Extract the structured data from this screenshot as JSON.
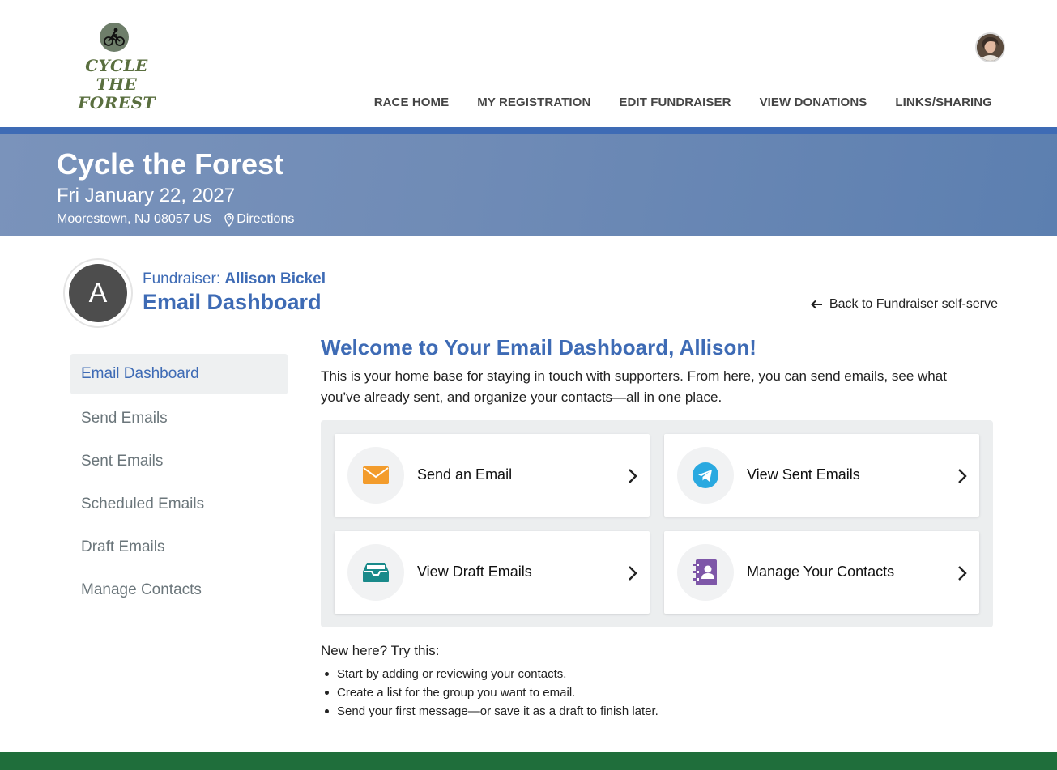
{
  "brand": {
    "logo_text": "CYCLE THE FOREST"
  },
  "nav": {
    "items": [
      {
        "label": "RACE HOME"
      },
      {
        "label": "MY REGISTRATION"
      },
      {
        "label": "EDIT FUNDRAISER"
      },
      {
        "label": "VIEW DONATIONS"
      },
      {
        "label": "LINKS/SHARING"
      }
    ]
  },
  "event": {
    "title": "Cycle the Forest",
    "date": "Fri January 22, 2027",
    "location": "Moorestown, NJ 08057 US",
    "directions_label": "Directions"
  },
  "fundraiser": {
    "initial": "A",
    "prefix": "Fundraiser: ",
    "name": "Allison Bickel",
    "page_title": "Email Dashboard",
    "back_label": "Back to Fundraiser self-serve"
  },
  "sidebar": {
    "items": [
      {
        "label": "Email Dashboard"
      },
      {
        "label": "Send Emails"
      },
      {
        "label": "Sent Emails"
      },
      {
        "label": "Scheduled Emails"
      },
      {
        "label": "Draft Emails"
      },
      {
        "label": "Manage Contacts"
      }
    ]
  },
  "main": {
    "welcome": "Welcome to Your Email Dashboard, Allison!",
    "intro": "This is your home base for staying in touch with supporters. From here, you can send emails, see what you’ve already sent, and organize your contacts—all in one place.",
    "cards": [
      {
        "label": "Send an Email",
        "icon": "envelope-icon",
        "color": "#f39c2c"
      },
      {
        "label": "View Sent Emails",
        "icon": "telegram-icon",
        "color": "#2aa9e0"
      },
      {
        "label": "View Draft Emails",
        "icon": "inbox-tray-icon",
        "color": "#1a8a8a"
      },
      {
        "label": "Manage Your Contacts",
        "icon": "contact-book-icon",
        "color": "#7e57a8"
      }
    ],
    "new_here": "New here? Try this:",
    "tips": [
      "Start by adding or reviewing your contacts.",
      "Create a list for the group you want to email.",
      "Send your first message—or save it as a draft to finish later."
    ]
  },
  "colors": {
    "accent": "#3e6bb5",
    "footer": "#1f6e3b",
    "logo_green": "#5a6f3f"
  }
}
